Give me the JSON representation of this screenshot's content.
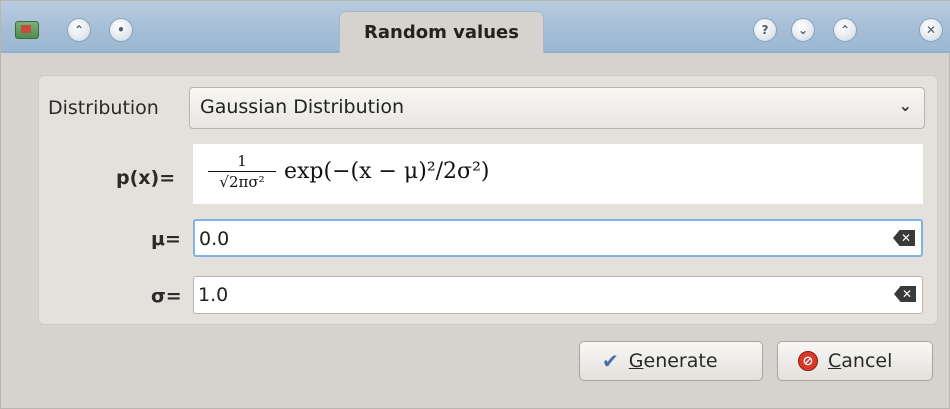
{
  "window": {
    "title": "Random values",
    "controls": {
      "left": [
        "app-icon",
        "keep-above-icon",
        "on-all-desktops-icon"
      ],
      "right": [
        "help-icon",
        "minimize-icon",
        "maximize-icon",
        "close-icon"
      ]
    }
  },
  "form": {
    "distribution_label": "Distribution",
    "distribution_value": "Gaussian Distribution",
    "formula_label": "p(x)=",
    "formula": {
      "numerator": "1",
      "denominator": "√2πσ²",
      "body": "exp(−(x − μ)²/2σ²)"
    },
    "mu_label": "μ=",
    "mu_value": "0.0",
    "sigma_label": "σ=",
    "sigma_value": "1.0"
  },
  "buttons": {
    "generate_accel": "G",
    "generate_rest": "enerate",
    "cancel_accel": "C",
    "cancel_rest": "ancel"
  }
}
